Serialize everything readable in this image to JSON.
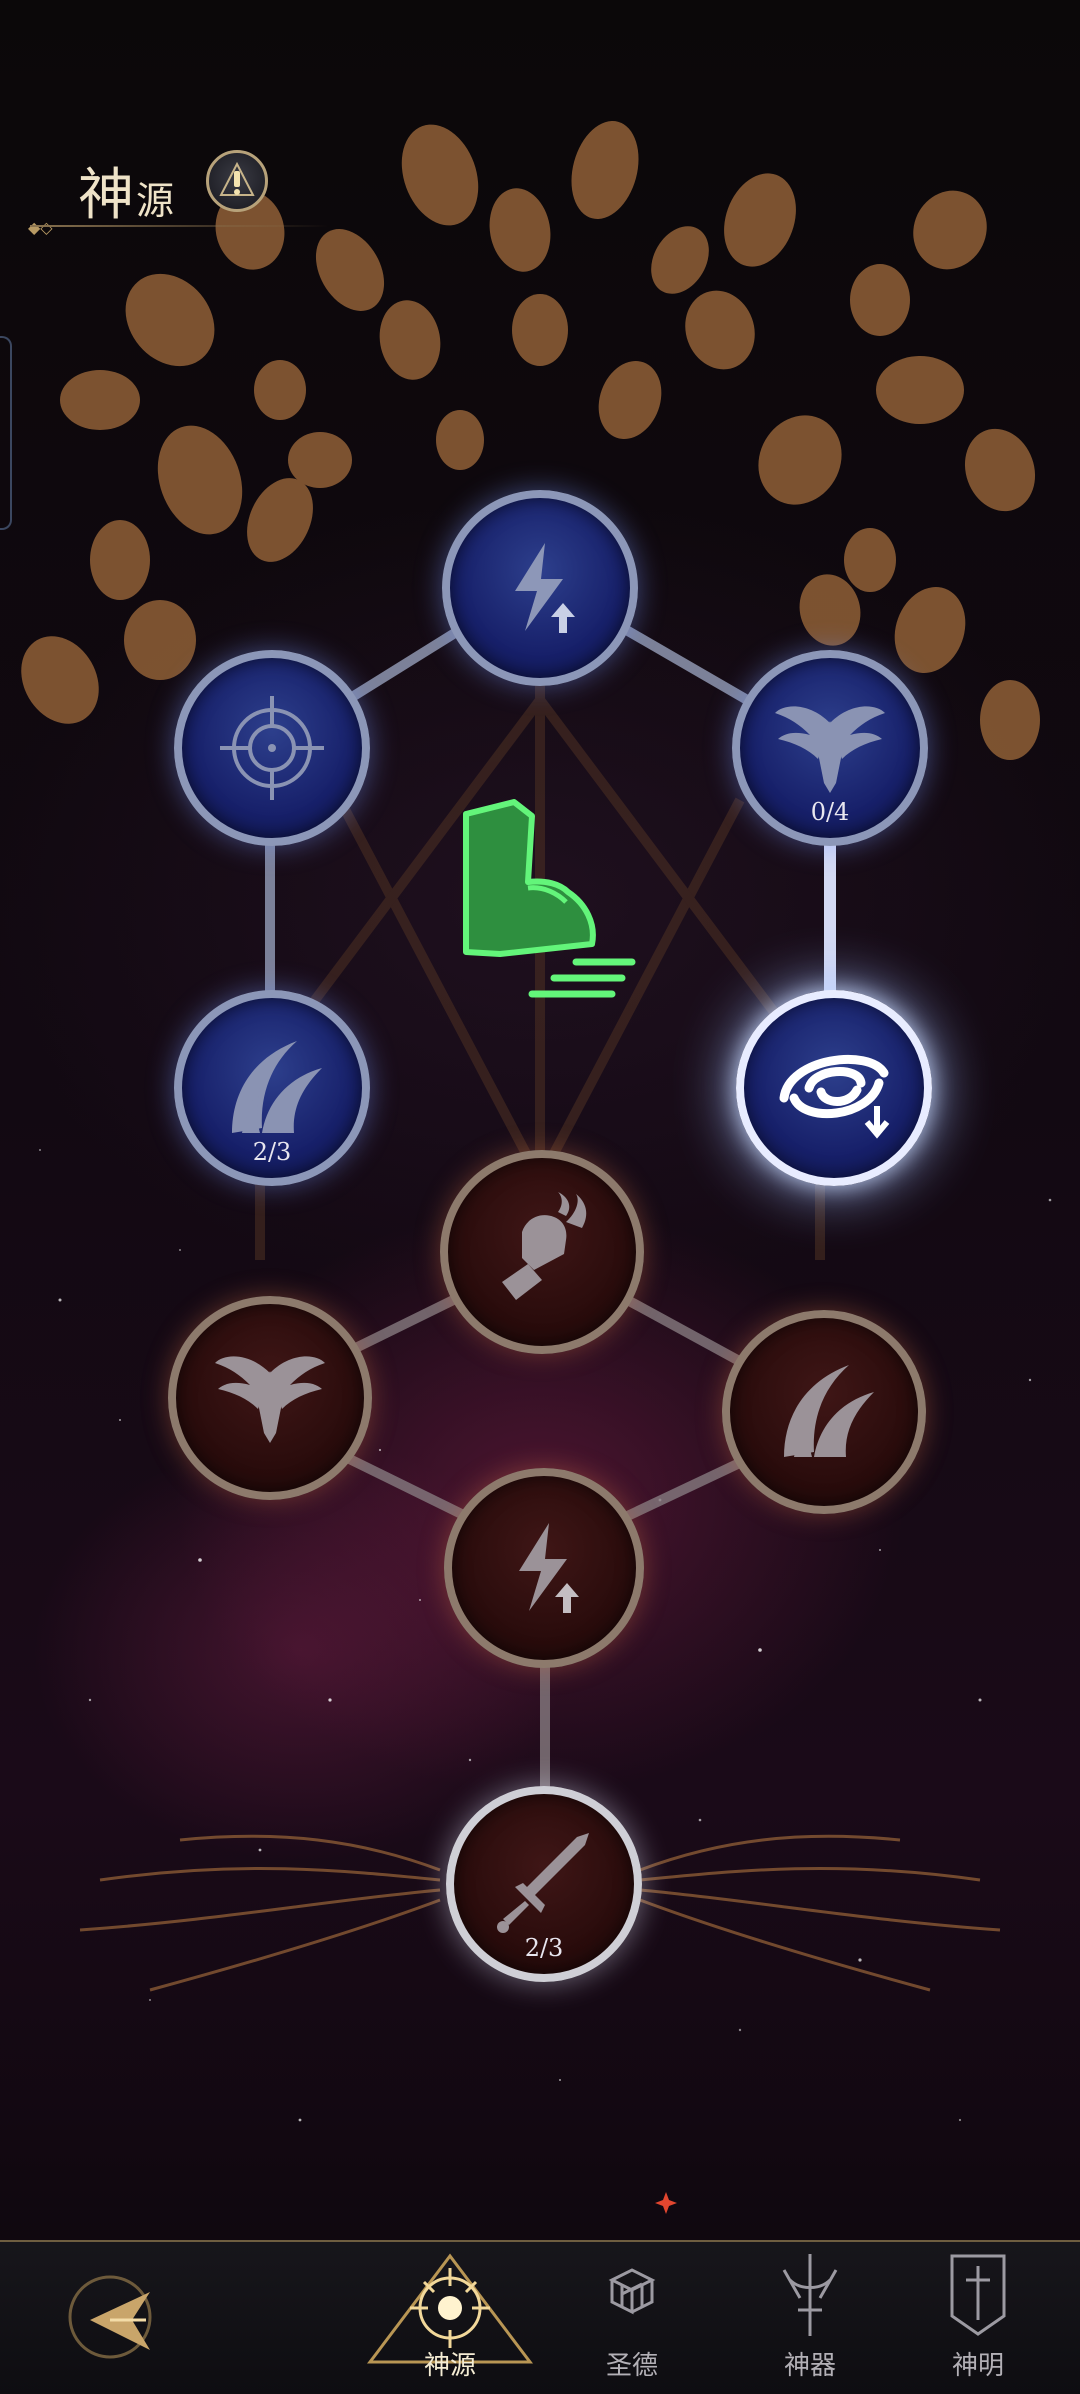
{
  "header": {
    "title_main": "神",
    "title_small": "源",
    "info_icon": "exclamation-icon"
  },
  "nodes": [
    {
      "id": "energy-top",
      "icon": "lightning-up-icon",
      "theme": "blue",
      "count": ""
    },
    {
      "id": "crosshair",
      "icon": "crosshair-icon",
      "theme": "blue",
      "count": ""
    },
    {
      "id": "wings-blue",
      "icon": "wings-icon",
      "theme": "blue",
      "count": "0/4"
    },
    {
      "id": "slash-blue",
      "icon": "slash-icon",
      "theme": "blue",
      "count": "2/3"
    },
    {
      "id": "vortex",
      "icon": "vortex-down-icon",
      "theme": "blue-active",
      "count": ""
    },
    {
      "id": "fist",
      "icon": "flaming-fist-icon",
      "theme": "red",
      "count": ""
    },
    {
      "id": "wings-red",
      "icon": "wings-icon",
      "theme": "red",
      "count": ""
    },
    {
      "id": "slash-red",
      "icon": "slash-icon",
      "theme": "red",
      "count": ""
    },
    {
      "id": "energy-red",
      "icon": "lightning-up-icon",
      "theme": "red",
      "count": ""
    },
    {
      "id": "sword",
      "icon": "sword-icon",
      "theme": "red-silver",
      "count": "2/3"
    }
  ],
  "center": {
    "icon": "speed-foot-icon",
    "color": "#3fd65a"
  },
  "nav": {
    "back_icon": "back-arrow-icon",
    "items": [
      {
        "label": "神源",
        "icon": "sun-emblem-icon",
        "selected": true
      },
      {
        "label": "圣德",
        "icon": "cubes-icon",
        "selected": false,
        "badge": true
      },
      {
        "label": "神器",
        "icon": "weapon-icon",
        "selected": false
      },
      {
        "label": "神明",
        "icon": "banner-icon",
        "selected": false
      }
    ]
  },
  "colors": {
    "gold": "#c9a56a",
    "blue_node": "#1a237a",
    "red_node": "#2c0d0d",
    "center_green": "#3fd65a"
  }
}
